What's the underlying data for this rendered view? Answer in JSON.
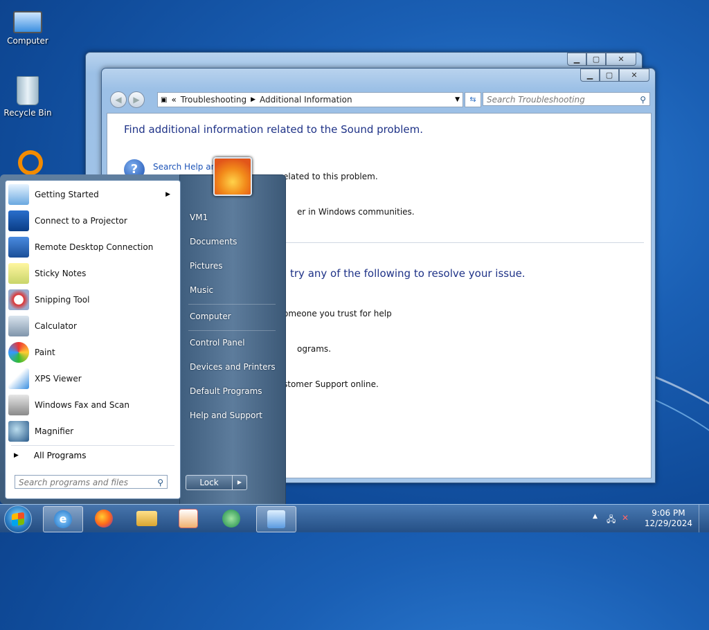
{
  "desktop": {
    "icons": [
      {
        "label": "Computer",
        "icon": "computer-icon"
      },
      {
        "label": "Recycle Bin",
        "icon": "recycle-bin-icon"
      }
    ]
  },
  "window_front": {
    "breadcrumb_root": "Troubleshooting",
    "breadcrumb_current": "Additional Information",
    "search_placeholder": "Search Troubleshooting",
    "heading_top": "Find additional information related to the Sound problem.",
    "help_link": "Search Help and",
    "line1": "elated to this problem.",
    "line2": "er in Windows communities.",
    "heading_bottom": "try any of the following to resolve your issue.",
    "line3": "omeone you trust for help",
    "line4": "ograms.",
    "line5": "stomer Support online."
  },
  "start_menu": {
    "programs": [
      {
        "label": "Getting Started",
        "icon": "getting-started-icon",
        "has_arrow": true
      },
      {
        "label": "Connect to a Projector",
        "icon": "projector-icon"
      },
      {
        "label": "Remote Desktop Connection",
        "icon": "remote-desktop-icon"
      },
      {
        "label": "Sticky Notes",
        "icon": "sticky-notes-icon"
      },
      {
        "label": "Snipping Tool",
        "icon": "snipping-tool-icon"
      },
      {
        "label": "Calculator",
        "icon": "calculator-icon"
      },
      {
        "label": "Paint",
        "icon": "paint-icon"
      },
      {
        "label": "XPS Viewer",
        "icon": "xps-viewer-icon"
      },
      {
        "label": "Windows Fax and Scan",
        "icon": "fax-scan-icon"
      },
      {
        "label": "Magnifier",
        "icon": "magnifier-icon"
      }
    ],
    "all_programs": "All Programs",
    "search_placeholder": "Search programs and files",
    "right_items": [
      "VM1",
      "Documents",
      "Pictures",
      "Music",
      "Computer",
      "Control Panel",
      "Devices and Printers",
      "Default Programs",
      "Help and Support"
    ],
    "lock_label": "Lock"
  },
  "taskbar": {
    "apps": [
      "internet-explorer-icon",
      "firefox-icon",
      "file-explorer-icon",
      "media-player-icon",
      "media-center-icon",
      "control-panel-icon"
    ],
    "time": "9:06 PM",
    "date": "12/29/2024"
  }
}
